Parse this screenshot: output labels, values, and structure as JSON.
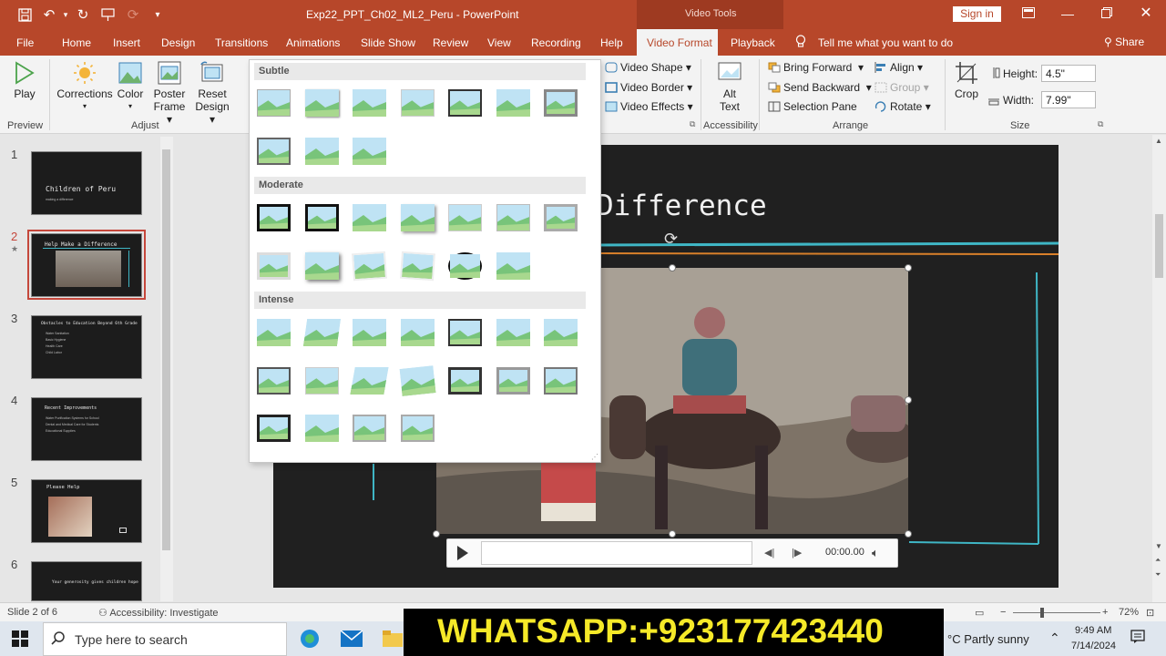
{
  "window": {
    "doc_title": "Exp22_PPT_Ch02_ML2_Peru  -  PowerPoint",
    "context_band": "Video Tools",
    "sign_in": "Sign in",
    "share": "Share"
  },
  "tabs": [
    {
      "label": "File"
    },
    {
      "label": "Home"
    },
    {
      "label": "Insert"
    },
    {
      "label": "Design"
    },
    {
      "label": "Transitions"
    },
    {
      "label": "Animations"
    },
    {
      "label": "Slide Show"
    },
    {
      "label": "Review"
    },
    {
      "label": "View"
    },
    {
      "label": "Recording"
    },
    {
      "label": "Help"
    },
    {
      "label": "Video Format"
    },
    {
      "label": "Playback"
    }
  ],
  "tell_me": "Tell me what you want to do",
  "ribbon": {
    "play": "Play",
    "corrections": "Corrections",
    "color": "Color",
    "poster_frame_1": "Poster",
    "poster_frame_2": "Frame",
    "reset_design_1": "Reset",
    "reset_design_2": "Design",
    "group_preview": "Preview",
    "group_adjust": "Adjust",
    "video_shape": "Video Shape",
    "video_border": "Video Border",
    "video_effects": "Video Effects",
    "alt_text_1": "Alt",
    "alt_text_2": "Text",
    "group_accessibility": "Accessibility",
    "bring_forward": "Bring Forward",
    "send_backward": "Send Backward",
    "selection_pane": "Selection Pane",
    "align": "Align",
    "group": "Group",
    "rotate": "Rotate",
    "group_arrange": "Arrange",
    "crop": "Crop",
    "height_label": "Height:",
    "height_value": "4.5\"",
    "width_label": "Width:",
    "width_value": "7.99\"",
    "group_size": "Size"
  },
  "gallery": {
    "sections": [
      {
        "name": "Subtle"
      },
      {
        "name": "Moderate"
      },
      {
        "name": "Intense"
      }
    ]
  },
  "slides": [
    {
      "num": "1",
      "title": "Children of Peru",
      "sub": "making a difference"
    },
    {
      "num": "2",
      "title": "Help Make a Difference"
    },
    {
      "num": "3",
      "title": "Obstacles to Education Beyond 6th Grade",
      "bullets": [
        "Water Sanitation",
        "Basic Hygiene",
        "Health Care",
        "Child Labor"
      ]
    },
    {
      "num": "4",
      "title": "Recent Improvements",
      "bullets": [
        "Water Purification Systems for School",
        "Dental and Medical Care for Students",
        "Educational Supplies"
      ]
    },
    {
      "num": "5",
      "title": "Please Help"
    },
    {
      "num": "6",
      "title": "Your generosity gives children hope"
    }
  ],
  "current_slide": {
    "title_visible": "Difference",
    "media_time": "00:00.00"
  },
  "status": {
    "slide_of": "Slide 2 of 6",
    "accessibility": "Accessibility: Investigate",
    "zoom": "72%"
  },
  "taskbar": {
    "search_placeholder": "Type here to search",
    "weather": "°C  Partly sunny",
    "time": "9:49 AM",
    "date": "7/14/2024"
  },
  "overlay_banner": "WHATSAPP:+923177423440",
  "colors": {
    "accent": "#b7472a",
    "slide_bg": "#202020",
    "teal_line": "#3fb6c5",
    "orange_line": "#d9802a",
    "banner_text": "#f5e928"
  }
}
